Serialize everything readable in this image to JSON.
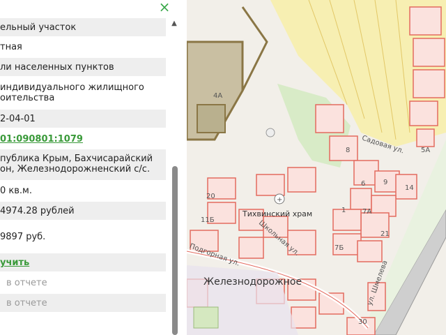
{
  "panel": {
    "close_icon": "×",
    "rows": [
      {
        "text": "ельный участок",
        "style": "normal"
      },
      {
        "text": "тная",
        "style": "normal"
      },
      {
        "text": "ли населенных пунктов",
        "style": "normal"
      },
      {
        "text": " индивидуального жилищного",
        "text2": "оительства",
        "style": "normal"
      },
      {
        "text": "2-04-01",
        "style": "normal"
      },
      {
        "text": "01:090801:1079",
        "style": "link"
      },
      {
        "text": "публика Крым, Бахчисарайский",
        "text2": "он, Железнодорожненский с/с.",
        "style": "normal"
      },
      {
        "text": "0 кв.м.",
        "style": "normal"
      },
      {
        "text": "4974.28 рублей",
        "style": "normal"
      },
      {
        "text": "9897 руб.",
        "style": "normal"
      },
      {
        "text": "учить",
        "style": "link"
      },
      {
        "text": "в отчете",
        "style": "muted"
      },
      {
        "text": "в отчете",
        "style": "muted"
      }
    ]
  },
  "map": {
    "labels": {
      "l4a": "4А",
      "l8": "8",
      "l5a": "5А",
      "sadovaya": "Садовая ул.",
      "l6": "6",
      "l9": "9",
      "l14": "14",
      "l20": "20",
      "l1": "1",
      "l7a": "7А",
      "l11b": "11Б",
      "l21": "21",
      "shkolnaya": "Школьная ул.",
      "l7b": "7Б",
      "podgornaya": "Подгорная ул.",
      "shmeleva": "ул. Шмелева",
      "l30": "30"
    },
    "church": "Тихвинский храм",
    "town": "Железнодорожное"
  }
}
